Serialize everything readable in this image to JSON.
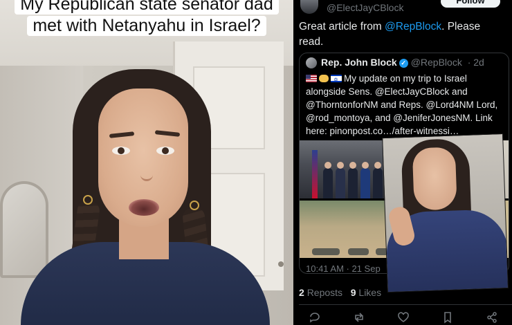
{
  "left": {
    "caption_line1": "My Republican state senator dad",
    "caption_line2": "met with Netanyahu in Israel?"
  },
  "tweet": {
    "handle": "@ElectJayCBlock",
    "follow_label": "Follow",
    "text_before": "Great article from ",
    "text_mention": "@RepBlock",
    "text_after": ". Please read."
  },
  "quote": {
    "name": "Rep. John Block",
    "handle": "@RepBlock",
    "age": "· 2d",
    "body": "My update on my trip to Israel alongside Sens. @ElectJayCBlock and @ThorntonforNM and Reps. @Lord4NM Lord, @rod_montoya, and @JeniferJonesNM. Link here: pinonpost.co…/after-witnessi…",
    "time": "10:41 AM · 21 Sep"
  },
  "stats": {
    "reposts_count": "2",
    "reposts_label": "Reposts",
    "likes_count": "9",
    "likes_label": "Likes"
  },
  "icons": {
    "reply": "reply-icon",
    "repost": "repost-icon",
    "like": "heart-icon",
    "bookmark": "bookmark-icon",
    "share": "share-icon"
  },
  "colors": {
    "link": "#1d9bf0",
    "background": "#000000",
    "muted": "#71767b"
  }
}
